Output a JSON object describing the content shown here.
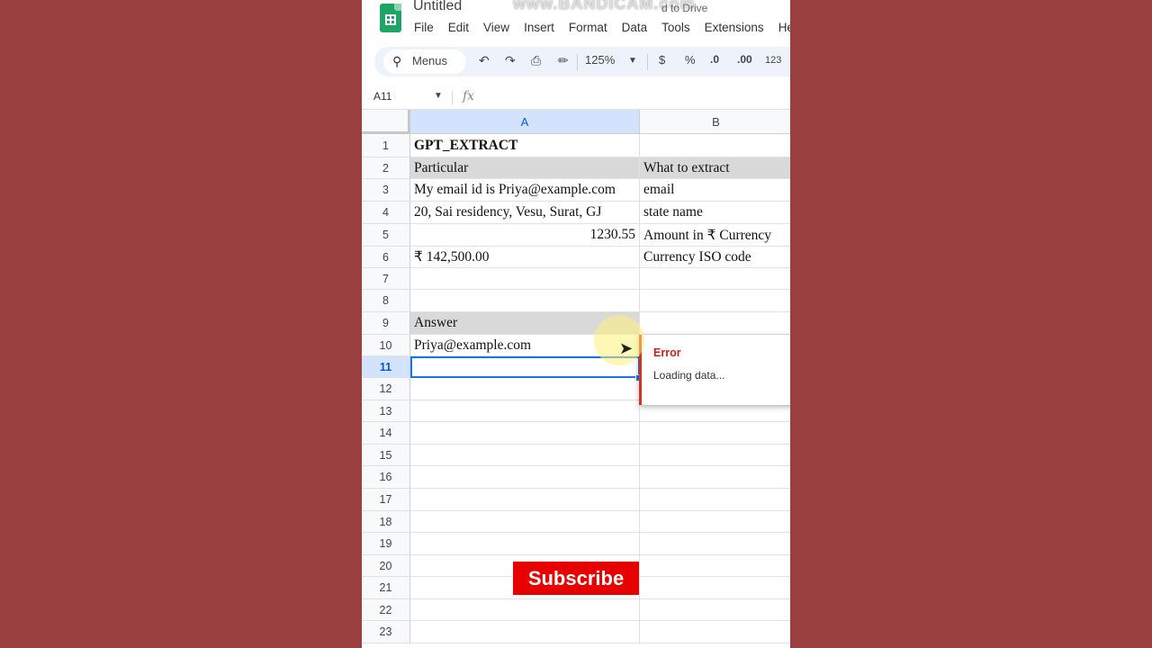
{
  "app": {
    "doc_title": "Untitled",
    "watermark": "www.BANDICAM.com",
    "save_status": "d to Drive"
  },
  "menu": [
    "File",
    "Edit",
    "View",
    "Insert",
    "Format",
    "Data",
    "Tools",
    "Extensions",
    "He"
  ],
  "toolbar": {
    "search_label": "Menus",
    "zoom": "125%",
    "currency": "$",
    "percent": "%",
    "dec_decrease": ".0",
    "dec_increase": ".00",
    "number_format": "123"
  },
  "formula_bar": {
    "name_box": "A11",
    "fx_label": "fx"
  },
  "columns": [
    "A",
    "B"
  ],
  "rows": [
    {
      "num": "1",
      "a": "GPT_EXTRACT",
      "b": ""
    },
    {
      "num": "2",
      "a": "Particular",
      "b": "What to extract"
    },
    {
      "num": "3",
      "a": "My email id is Priya@example.com",
      "b": "email"
    },
    {
      "num": "4",
      "a": "20, Sai residency, Vesu, Surat, GJ",
      "b": "state name"
    },
    {
      "num": "5",
      "a": "1230.55",
      "b": "Amount in ₹ Currency"
    },
    {
      "num": "6",
      "a": "₹ 142,500.00",
      "b": "Currency ISO code"
    },
    {
      "num": "7",
      "a": "",
      "b": ""
    },
    {
      "num": "8",
      "a": "",
      "b": ""
    },
    {
      "num": "9",
      "a": "Answer",
      "b": ""
    },
    {
      "num": "10",
      "a": "Priya@example.com",
      "b": ""
    },
    {
      "num": "11",
      "a": "",
      "b": ""
    },
    {
      "num": "12",
      "a": "",
      "b": ""
    },
    {
      "num": "13",
      "a": "",
      "b": ""
    },
    {
      "num": "14",
      "a": "",
      "b": ""
    },
    {
      "num": "15",
      "a": "",
      "b": ""
    },
    {
      "num": "16",
      "a": "",
      "b": ""
    },
    {
      "num": "17",
      "a": "",
      "b": ""
    },
    {
      "num": "18",
      "a": "",
      "b": ""
    },
    {
      "num": "19",
      "a": "",
      "b": ""
    },
    {
      "num": "20",
      "a": "",
      "b": ""
    },
    {
      "num": "21",
      "a": "",
      "b": ""
    },
    {
      "num": "22",
      "a": "",
      "b": ""
    },
    {
      "num": "23",
      "a": "",
      "b": ""
    }
  ],
  "error_tooltip": {
    "title": "Error",
    "message": "Loading data..."
  },
  "overlay": {
    "subscribe": "Subscribe"
  },
  "colors": {
    "background": "#923b3b",
    "selection": "#1a73e8",
    "error": "#d93025",
    "subscribe": "#e60000"
  }
}
